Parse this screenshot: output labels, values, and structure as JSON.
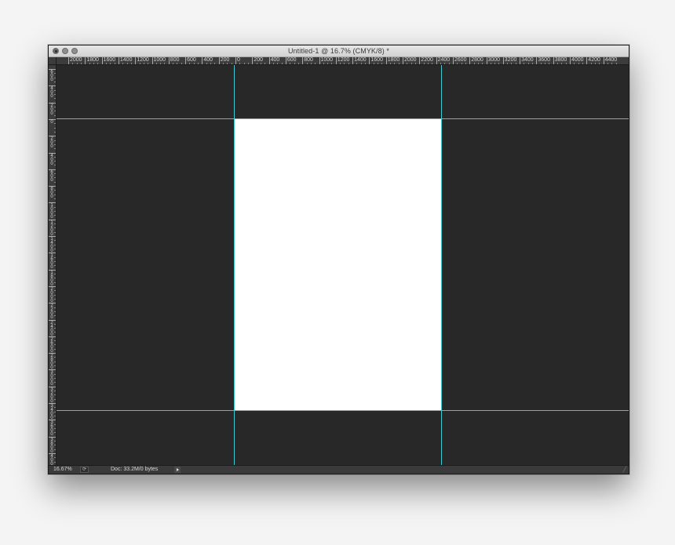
{
  "window": {
    "title": "Untitled-1 @ 16.7% (CMYK/8) *"
  },
  "ruler_h": {
    "labels": [
      "2000",
      "1800",
      "1600",
      "1400",
      "1200",
      "1000",
      "800",
      "600",
      "400",
      "200",
      "0",
      "200",
      "400",
      "600",
      "800",
      "1000",
      "1200",
      "1400",
      "1600",
      "1800",
      "2000",
      "2200",
      "2400",
      "2600",
      "2800",
      "3000",
      "3200",
      "3400",
      "3600",
      "3800",
      "4000",
      "4200",
      "4400"
    ]
  },
  "ruler_v": {
    "labels": [
      "600",
      "400",
      "200",
      "0",
      "200",
      "400",
      "600",
      "800",
      "1000",
      "1200",
      "1400",
      "1600",
      "1800",
      "2000",
      "2200",
      "2400",
      "2600",
      "2800",
      "3000",
      "3200",
      "3400",
      "3600",
      "3800",
      "4000"
    ]
  },
  "status": {
    "zoom": "16.67%",
    "doc_info": "Doc: 33.2M/0 bytes",
    "history_icon": "rotate-icon",
    "menu_icon": "play-triangle-icon"
  },
  "colors": {
    "guide": "#3ec8d0",
    "pasteboard": "#282828",
    "artboard": "#ffffff"
  }
}
